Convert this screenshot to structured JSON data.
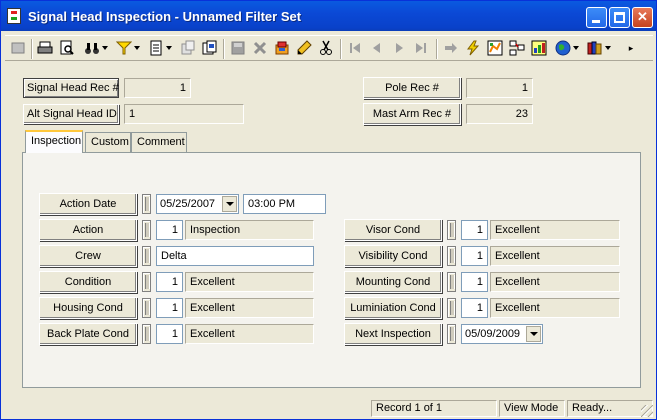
{
  "window": {
    "title": "Signal Head Inspection - Unnamed Filter Set"
  },
  "toolbar": {
    "icons": [
      "new-record-icon",
      "print-icon",
      "print-preview-icon",
      "binoculars-find-icon",
      "filter-icon",
      "report-icon",
      "copy-record-icon",
      "paste-record-icon",
      "save-icon",
      "delete-icon",
      "attachments-icon",
      "edit-pencil-icon",
      "cut-icon",
      "first-record-icon",
      "previous-record-icon",
      "next-record-icon",
      "last-record-icon",
      "goto-icon",
      "lightning-icon",
      "map-icon",
      "hierarchy-icon",
      "chart-icon",
      "globe-icon",
      "books-icon"
    ]
  },
  "header": {
    "signal_head_rec_label": "Signal Head Rec #",
    "signal_head_rec_value": "1",
    "alt_signal_head_id_label": "Alt Signal Head  ID",
    "alt_signal_head_id_value": "1",
    "pole_rec_label": "Pole Rec #",
    "pole_rec_value": "1",
    "mast_arm_rec_label": "Mast Arm Rec #",
    "mast_arm_rec_value": "23"
  },
  "tabs": [
    {
      "label": "Inspection",
      "active": true
    },
    {
      "label": "Custom",
      "active": false
    },
    {
      "label": "Comment",
      "active": false
    }
  ],
  "inspection": {
    "action_date_label": "Action Date",
    "action_date_value": "05/25/2007",
    "action_time_value": "03:00 PM",
    "action_label": "Action",
    "action_code": "1",
    "action_desc": "Inspection",
    "crew_label": "Crew",
    "crew_value": "Delta",
    "condition_label": "Condition",
    "condition_code": "1",
    "condition_desc": "Excellent",
    "housing_cond_label": "Housing Cond",
    "housing_cond_code": "1",
    "housing_cond_desc": "Excellent",
    "back_plate_cond_label": "Back Plate Cond",
    "back_plate_cond_code": "1",
    "back_plate_cond_desc": "Excellent",
    "visor_cond_label": "Visor Cond",
    "visor_cond_code": "1",
    "visor_cond_desc": "Excellent",
    "visibility_cond_label": "Visibility Cond",
    "visibility_cond_code": "1",
    "visibility_cond_desc": "Excellent",
    "mounting_cond_label": "Mounting Cond",
    "mounting_cond_code": "1",
    "mounting_cond_desc": "Excellent",
    "luminiation_cond_label": "Luminiation Cond",
    "luminiation_cond_code": "1",
    "luminiation_cond_desc": "Excellent",
    "next_inspection_label": "Next Inspection",
    "next_inspection_value": "05/09/2009"
  },
  "status": {
    "record": "Record 1 of 1",
    "mode": "View Mode",
    "state": "Ready..."
  }
}
